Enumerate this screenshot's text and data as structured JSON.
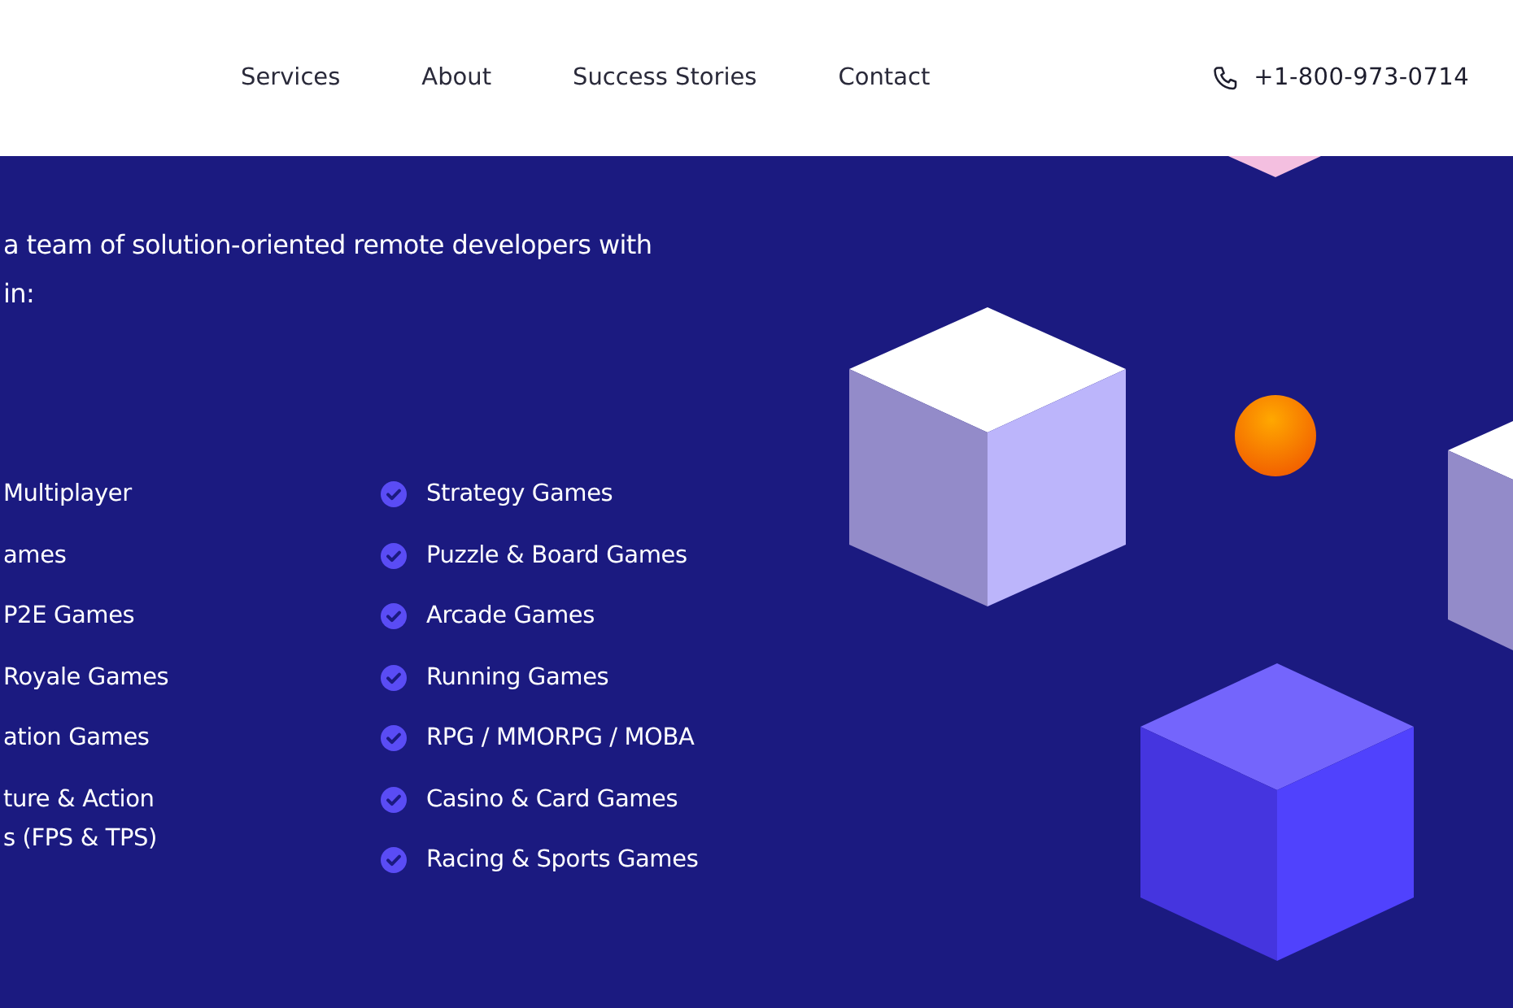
{
  "nav": {
    "links": [
      {
        "label": "Services"
      },
      {
        "label": "About"
      },
      {
        "label": "Success Stories"
      },
      {
        "label": "Contact"
      }
    ],
    "phone": "+1-800-973-0714"
  },
  "intro": {
    "lines": [
      "a team of solution-oriented remote developers with",
      "in:"
    ]
  },
  "game_types": {
    "column_1": [
      {
        "label": "Multiplayer"
      },
      {
        "label": "ames"
      },
      {
        "label": "P2E Games"
      },
      {
        "label": "Royale Games"
      },
      {
        "label": "ation Games"
      },
      {
        "label": "ture & Action\ns (FPS & TPS)"
      }
    ],
    "column_2": [
      {
        "label": "Strategy Games"
      },
      {
        "label": "Puzzle & Board Games"
      },
      {
        "label": "Arcade Games"
      },
      {
        "label": "Running Games"
      },
      {
        "label": "RPG / MMORPG / MOBA"
      },
      {
        "label": "Casino & Card Games"
      },
      {
        "label": "Racing & Sports Games"
      }
    ]
  }
}
